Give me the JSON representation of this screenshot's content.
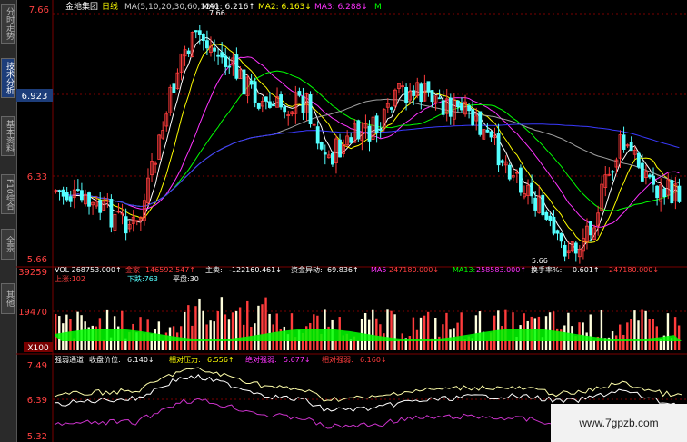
{
  "sidebar": {
    "tabs": [
      {
        "label": "分时走势",
        "active": false
      },
      {
        "label": "技术分析",
        "active": true
      },
      {
        "label": "基本资料",
        "active": false
      },
      {
        "label": "F10综合",
        "active": false
      },
      {
        "label": "全景",
        "active": false
      },
      {
        "label": "其他",
        "active": false
      }
    ]
  },
  "price_panel": {
    "stock_name": "金地集团",
    "period": "日线",
    "ma_params": "MA(5,10,20,30,60,120)",
    "ma1": "MA1: 6.216↑",
    "ma2": "MA2: 6.163↓",
    "ma3": "MA3: 6.288↓",
    "ma4": "M",
    "axis_top": "7.66",
    "axis_mid": "6.33",
    "axis_low": "5.66",
    "current_price": "6.923",
    "high_label": "7.66",
    "low_label": "5.66"
  },
  "volume_panel": {
    "vol": "VOL  268753.000↑",
    "ma5_label": "金家",
    "ma5_value": "146592.547↑",
    "main_label": "主卖:",
    "main_value": "-122160.461↓",
    "flow_label": "资金异动:",
    "flow_value": "69.836↑",
    "m5": "MA5",
    "m5_value": "247180.000↓",
    "m13": "MA13:",
    "m13_value": "258583.000↑",
    "turnover_label": "换手率%:",
    "turnover_value": "0.601↑",
    "turnover_value2": "247180.000↓",
    "up_label": "上涨:102",
    "down_label": "下跌:763",
    "flat_label": "平盘:30",
    "axis_top": "39259",
    "axis_mid": "19470",
    "axis_bottom": "X100"
  },
  "indicator_panel": {
    "name": "强弱通道",
    "close_label": "收盘价位:",
    "close_value": "6.140↓",
    "resist_label": "相对压力:",
    "resist_value": "6.556↑",
    "strong_label": "绝对强弱:",
    "strong_value": "5.677↓",
    "rel_label": "相对强弱:",
    "rel_value": "6.160↓",
    "axis_top": "7.49",
    "axis_mid": "6.39",
    "axis_low": "5.32"
  },
  "watermark": "www.7gpzb.com",
  "colors": {
    "up": "#ff3c3c",
    "down": "#54ffff",
    "ma1": "#ffffff",
    "ma2": "#ffff00",
    "ma3": "#ff33ff",
    "ma4": "#00ff00",
    "ma_long": "#3a3aff",
    "grid": "#7a0000"
  }
}
